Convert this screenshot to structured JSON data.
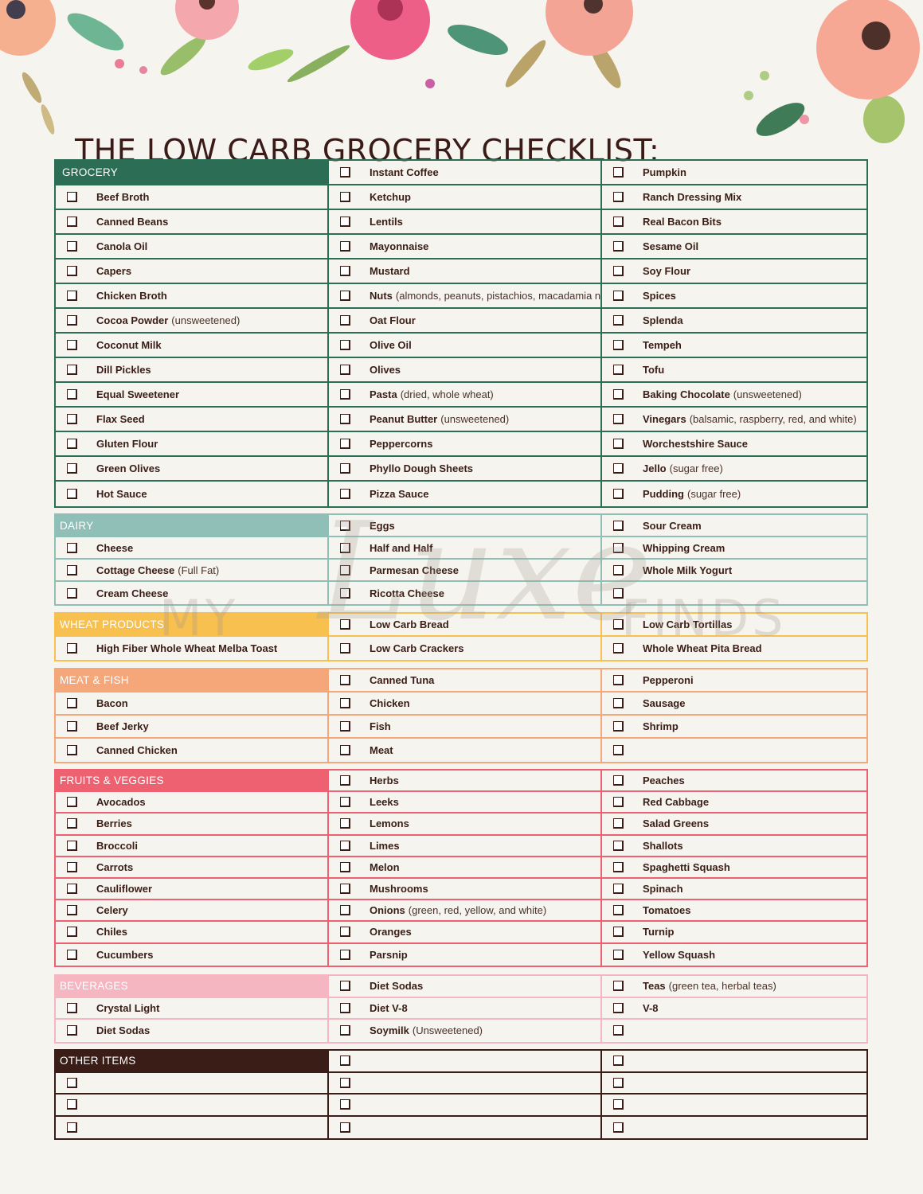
{
  "page": {
    "title": "THE LOW CARB GROCERY CHECKLIST:",
    "watermark": {
      "left": "MY",
      "script": "Luxe",
      "right": "FINDS"
    },
    "colors": {
      "grocery": "#2b6e55",
      "dairy": "#8fbfb6",
      "wheat_products": "#f7c04f",
      "meat_fish": "#f5a77a",
      "fruits_veggies": "#ee6171",
      "beverages": "#f5b5c1",
      "other_items": "#3b1d17",
      "text": "#3a1d17",
      "background": "#f6f4ee"
    }
  },
  "sections": [
    {
      "id": "grocery",
      "header": "GROCERY",
      "cells": [
        {
          "header": true
        },
        {
          "name": "Instant Coffee"
        },
        {
          "name": "Pumpkin"
        },
        {
          "name": "Beef Broth"
        },
        {
          "name": "Ketchup"
        },
        {
          "name": "Ranch Dressing Mix"
        },
        {
          "name": "Canned Beans"
        },
        {
          "name": "Lentils"
        },
        {
          "name": "Real Bacon Bits"
        },
        {
          "name": "Canola Oil"
        },
        {
          "name": "Mayonnaise"
        },
        {
          "name": "Sesame Oil"
        },
        {
          "name": "Capers"
        },
        {
          "name": "Mustard"
        },
        {
          "name": "Soy Flour"
        },
        {
          "name": "Chicken Broth"
        },
        {
          "name": "Nuts",
          "note": "(almonds, peanuts, pistachios, macadamia nuts)"
        },
        {
          "name": "Spices"
        },
        {
          "name": "Cocoa Powder",
          "note": "(unsweetened)"
        },
        {
          "name": "Oat Flour"
        },
        {
          "name": "Splenda"
        },
        {
          "name": "Coconut Milk"
        },
        {
          "name": "Olive Oil"
        },
        {
          "name": "Tempeh"
        },
        {
          "name": "Dill Pickles"
        },
        {
          "name": "Olives"
        },
        {
          "name": "Tofu"
        },
        {
          "name": "Equal Sweetener"
        },
        {
          "name": "Pasta",
          "note": "(dried, whole wheat)"
        },
        {
          "name": "Baking Chocolate",
          "note": " (unsweetened)"
        },
        {
          "name": "Flax Seed"
        },
        {
          "name": "Peanut Butter",
          "note": " (unsweetened)"
        },
        {
          "name": "Vinegars",
          "note": "(balsamic, raspberry, red, and white)"
        },
        {
          "name": "Gluten Flour"
        },
        {
          "name": "Peppercorns"
        },
        {
          "name": "Worchestshire Sauce"
        },
        {
          "name": "Green Olives"
        },
        {
          "name": "Phyllo Dough Sheets"
        },
        {
          "name": "Jello",
          "note": "(sugar free)"
        },
        {
          "name": "Hot Sauce"
        },
        {
          "name": "Pizza Sauce"
        },
        {
          "name": "Pudding",
          "note": "(sugar free)"
        }
      ]
    },
    {
      "id": "dairy",
      "header": "DAIRY",
      "cells": [
        {
          "header": true
        },
        {
          "name": "Eggs"
        },
        {
          "name": "Sour Cream"
        },
        {
          "name": "Cheese"
        },
        {
          "name": "Half and Half"
        },
        {
          "name": "Whipping Cream"
        },
        {
          "name": "Cottage Cheese",
          "note": "(Full Fat)"
        },
        {
          "name": "Parmesan Cheese"
        },
        {
          "name": "Whole Milk Yogurt"
        },
        {
          "name": "Cream Cheese"
        },
        {
          "name": "Ricotta Cheese"
        },
        {
          "name": ""
        }
      ]
    },
    {
      "id": "wheat",
      "header": "WHEAT PRODUCTS",
      "cells": [
        {
          "header": true
        },
        {
          "name": "Low Carb Bread"
        },
        {
          "name": "Low Carb Tortillas"
        },
        {
          "name": "High Fiber Whole Wheat Melba Toast"
        },
        {
          "name": "Low Carb Crackers"
        },
        {
          "name": "Whole Wheat Pita Bread"
        }
      ]
    },
    {
      "id": "meat",
      "header": "MEAT & FISH",
      "cells": [
        {
          "header": true
        },
        {
          "name": "Canned Tuna"
        },
        {
          "name": "Pepperoni"
        },
        {
          "name": "Bacon"
        },
        {
          "name": "Chicken"
        },
        {
          "name": "Sausage"
        },
        {
          "name": "Beef Jerky"
        },
        {
          "name": "Fish"
        },
        {
          "name": "Shrimp"
        },
        {
          "name": "Canned Chicken"
        },
        {
          "name": "Meat"
        },
        {
          "name": ""
        }
      ]
    },
    {
      "id": "fruits",
      "header": "FRUITS & VEGGIES",
      "cells": [
        {
          "header": true
        },
        {
          "name": "Herbs"
        },
        {
          "name": "Peaches"
        },
        {
          "name": "Avocados"
        },
        {
          "name": "Leeks"
        },
        {
          "name": "Red Cabbage"
        },
        {
          "name": "Berries"
        },
        {
          "name": "Lemons"
        },
        {
          "name": "Salad Greens"
        },
        {
          "name": "Broccoli"
        },
        {
          "name": "Limes"
        },
        {
          "name": "Shallots"
        },
        {
          "name": "Carrots"
        },
        {
          "name": "Melon"
        },
        {
          "name": "Spaghetti Squash"
        },
        {
          "name": "Cauliflower"
        },
        {
          "name": "Mushrooms"
        },
        {
          "name": "Spinach"
        },
        {
          "name": "Celery"
        },
        {
          "name": "Onions",
          "note": "(green, red, yellow, and white)"
        },
        {
          "name": "Tomatoes"
        },
        {
          "name": "Chiles"
        },
        {
          "name": "Oranges"
        },
        {
          "name": "Turnip"
        },
        {
          "name": "Cucumbers"
        },
        {
          "name": "Parsnip"
        },
        {
          "name": "Yellow Squash"
        }
      ]
    },
    {
      "id": "beverages",
      "header": "BEVERAGES",
      "cells": [
        {
          "header": true
        },
        {
          "name": "Diet Sodas"
        },
        {
          "name": "Teas",
          "note": "(green tea, herbal teas)"
        },
        {
          "name": "Crystal Light"
        },
        {
          "name": "Diet V-8"
        },
        {
          "name": "V-8"
        },
        {
          "name": "Diet Sodas"
        },
        {
          "name": "Soymilk",
          "note": "(Unsweetened)"
        },
        {
          "name": ""
        }
      ]
    },
    {
      "id": "other",
      "header": "OTHER ITEMS",
      "cells": [
        {
          "header": true
        },
        {
          "name": ""
        },
        {
          "name": ""
        },
        {
          "name": ""
        },
        {
          "name": ""
        },
        {
          "name": ""
        },
        {
          "name": ""
        },
        {
          "name": ""
        },
        {
          "name": ""
        },
        {
          "name": ""
        },
        {
          "name": ""
        },
        {
          "name": ""
        }
      ]
    }
  ]
}
